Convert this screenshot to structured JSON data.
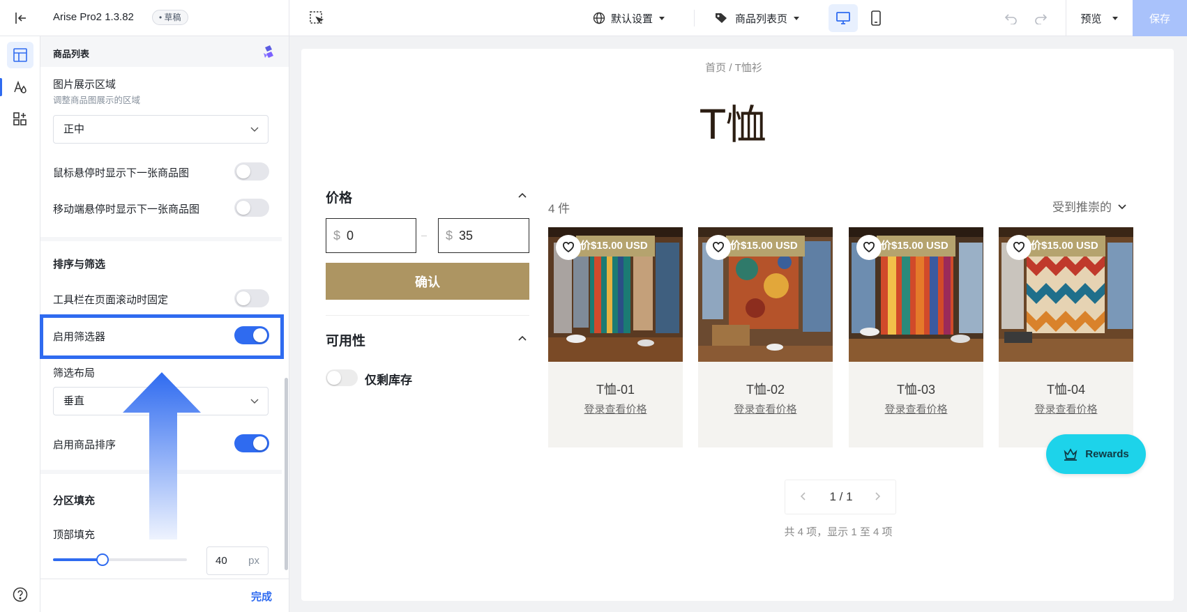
{
  "topbar": {
    "app_name": "Arise Pro2  1.3.82",
    "draft_badge": "• 草稿",
    "theme_select": "默认设置",
    "page_select": "商品列表页",
    "preview_label": "预览",
    "save_label": "保存"
  },
  "panel": {
    "title": "商品列表",
    "image_area": {
      "label": "图片展示区域",
      "hint": "调整商品图展示的区域",
      "value": "正中"
    },
    "hover_next_image": {
      "label": "鼠标悬停时显示下一张商品图",
      "enabled": false
    },
    "mobile_hover_next_image": {
      "label": "移动端悬停时显示下一张商品图",
      "enabled": false
    },
    "sorting_section": "排序与筛选",
    "sticky_toolbar": {
      "label": "工具栏在页面滚动时固定",
      "enabled": false
    },
    "enable_filter": {
      "label": "启用筛选器",
      "enabled": true
    },
    "filter_layout": {
      "label": "筛选布局",
      "value": "垂直"
    },
    "enable_sorting": {
      "label": "启用商品排序",
      "enabled": true
    },
    "padding_section": "分区填充",
    "top_padding": {
      "label": "顶部填充",
      "value": "40",
      "unit": "px",
      "fraction": 0.37
    },
    "done_label": "完成"
  },
  "preview": {
    "breadcrumb": "首页 / T恤衫",
    "heading": "T恤",
    "filters": {
      "price_title": "价格",
      "min_currency": "$",
      "min_value": "0",
      "max_currency": "$",
      "max_value": "35",
      "confirm_label": "确认",
      "availability_title": "可用性",
      "in_stock_label": "仅剩库存"
    },
    "count": "4 件",
    "sort": "受到推崇的",
    "products": [
      {
        "price": "价$15.00 USD",
        "name": "T恤-01",
        "link": "登录查看价格"
      },
      {
        "price": "价$15.00 USD",
        "name": "T恤-02",
        "link": "登录查看价格"
      },
      {
        "price": "价$15.00 USD",
        "name": "T恤-03",
        "link": "登录查看价格"
      },
      {
        "price": "价$15.00 USD",
        "name": "T恤-04",
        "link": "登录查看价格"
      }
    ],
    "pagination": "1 / 1",
    "summary": "共 4 项，显示 1 至 4 项",
    "rewards_label": "Rewards"
  },
  "colors": {
    "accent": "#2f6bf0",
    "confirm": "#ad9562",
    "price_badge": "#b5a36e",
    "rewards": "#1dd3ea"
  }
}
